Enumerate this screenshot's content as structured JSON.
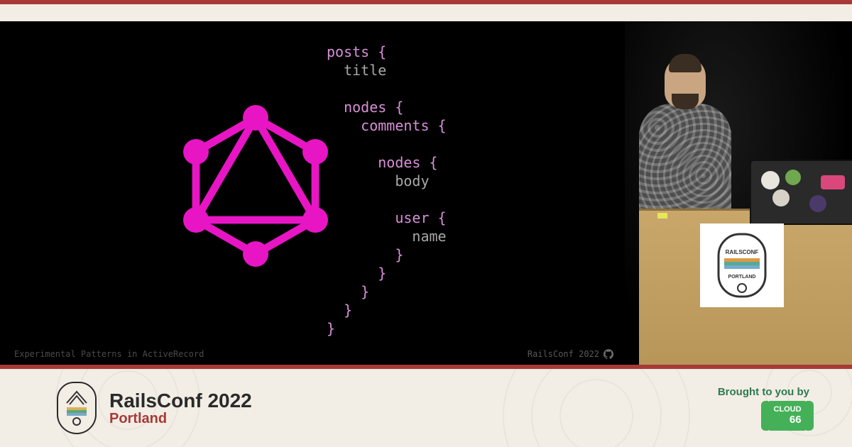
{
  "slide": {
    "code_lines": [
      {
        "indent": 0,
        "tokens": [
          {
            "t": "kw",
            "v": "posts"
          },
          {
            "t": "sp",
            "v": " "
          },
          {
            "t": "br",
            "v": "{"
          }
        ]
      },
      {
        "indent": 1,
        "tokens": [
          {
            "t": "fld",
            "v": "title"
          }
        ]
      },
      {
        "indent": 0,
        "tokens": []
      },
      {
        "indent": 1,
        "tokens": [
          {
            "t": "kw",
            "v": "nodes"
          },
          {
            "t": "sp",
            "v": " "
          },
          {
            "t": "br",
            "v": "{"
          }
        ]
      },
      {
        "indent": 2,
        "tokens": [
          {
            "t": "kw",
            "v": "comments"
          },
          {
            "t": "sp",
            "v": " "
          },
          {
            "t": "br",
            "v": "{"
          }
        ]
      },
      {
        "indent": 0,
        "tokens": []
      },
      {
        "indent": 3,
        "tokens": [
          {
            "t": "kw",
            "v": "nodes"
          },
          {
            "t": "sp",
            "v": " "
          },
          {
            "t": "br",
            "v": "{"
          }
        ]
      },
      {
        "indent": 4,
        "tokens": [
          {
            "t": "fld",
            "v": "body"
          }
        ]
      },
      {
        "indent": 0,
        "tokens": []
      },
      {
        "indent": 4,
        "tokens": [
          {
            "t": "kw",
            "v": "user"
          },
          {
            "t": "sp",
            "v": " "
          },
          {
            "t": "br",
            "v": "{"
          }
        ]
      },
      {
        "indent": 5,
        "tokens": [
          {
            "t": "fld",
            "v": "name"
          }
        ]
      },
      {
        "indent": 4,
        "tokens": [
          {
            "t": "br",
            "v": "}"
          }
        ]
      },
      {
        "indent": 3,
        "tokens": [
          {
            "t": "br",
            "v": "}"
          }
        ]
      },
      {
        "indent": 2,
        "tokens": [
          {
            "t": "br",
            "v": "}"
          }
        ]
      },
      {
        "indent": 1,
        "tokens": [
          {
            "t": "br",
            "v": "}"
          }
        ]
      },
      {
        "indent": 0,
        "tokens": [
          {
            "t": "br",
            "v": "}"
          }
        ]
      }
    ],
    "footer_left": "Experimental Patterns in ActiveRecord",
    "footer_right": "RailsConf 2022",
    "logo_color": "#e815c5"
  },
  "conference": {
    "title": "RailsConf 2022",
    "location": "Portland",
    "podium_sign_top": "RAILSCONF",
    "podium_sign_bottom": "PORTLAND"
  },
  "sponsor": {
    "lead_in": "Brought to you by",
    "name_top": "CLOUD",
    "name_num": "66"
  },
  "colors": {
    "accent_red": "#a73a37",
    "graphql_pink": "#e815c5",
    "cream": "#f2ede5"
  }
}
